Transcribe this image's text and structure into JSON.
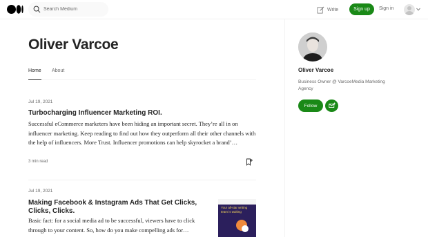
{
  "header": {
    "search_placeholder": "Search Medium",
    "write_label": "Write",
    "signup_label": "Sign up",
    "signin_label": "Sign in"
  },
  "profile": {
    "name": "Oliver Varcoe",
    "tabs": [
      {
        "label": "Home",
        "active": true
      },
      {
        "label": "About",
        "active": false
      }
    ]
  },
  "articles": [
    {
      "date": "Jul 19, 2021",
      "title": "Turbocharging Influencer Marketing ROI.",
      "excerpt": "Successful eCommerce marketers have been hiding an important secret. They’re all in on influencer marketing. Keep reading to find out how they outperform all their other channels with the help of influencers. More Trust. Influencer promotions can help skyrocket a brand’…",
      "read_time": "3 min read"
    },
    {
      "date": "Jul 19, 2021",
      "title": "Making Facebook & Instagram Ads That Get Clicks, Clicks, Clicks.",
      "excerpt": "Basic fact: for a social media ad to be successful, viewers have to click through to your content. So, how do you make compelling ads for…",
      "thumbnail_text": "Your all-star writing team is waiting"
    }
  ],
  "sidebar": {
    "name": "Oliver Varcoe",
    "bio": "Business Owner @ VarcoeMedia Marketing Agency",
    "follow_label": "Follow"
  },
  "colors": {
    "accent": "#1a8917",
    "text": "#242424",
    "muted": "#6b6b6b"
  }
}
